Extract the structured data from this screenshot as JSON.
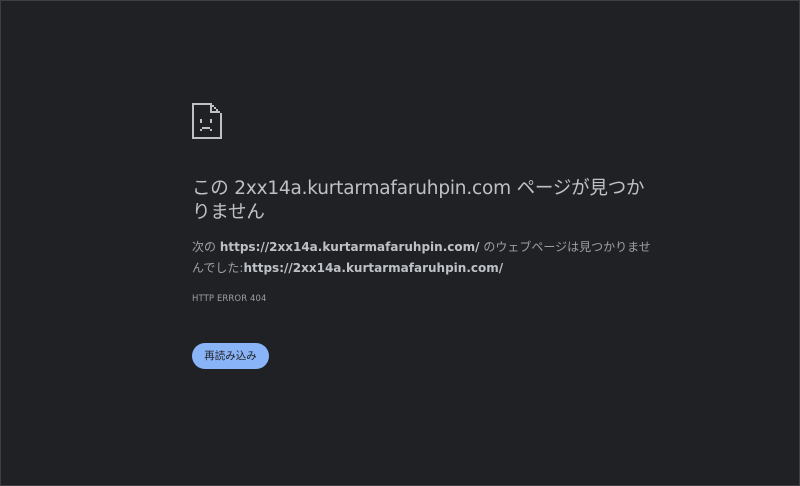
{
  "error_page": {
    "icon": "sad-document-icon",
    "headline": "この 2xx14a.kurtarmafaruhpin.com ページが見つかりません",
    "description": {
      "prefix": "次の ",
      "url": "https://2xx14a.kurtarmafaruhpin.com/",
      "middle": " のウェブページは見つかりませんでした:",
      "url_repeat": "https://2xx14a.kurtarmafaruhpin.com/"
    },
    "error_code": "HTTP ERROR 404",
    "reload_label": "再読み込み"
  },
  "colors": {
    "background": "#202124",
    "text_primary": "#bdc1c6",
    "text_secondary": "#9aa0a6",
    "button_bg": "#8ab4f8",
    "button_text": "#202124"
  }
}
